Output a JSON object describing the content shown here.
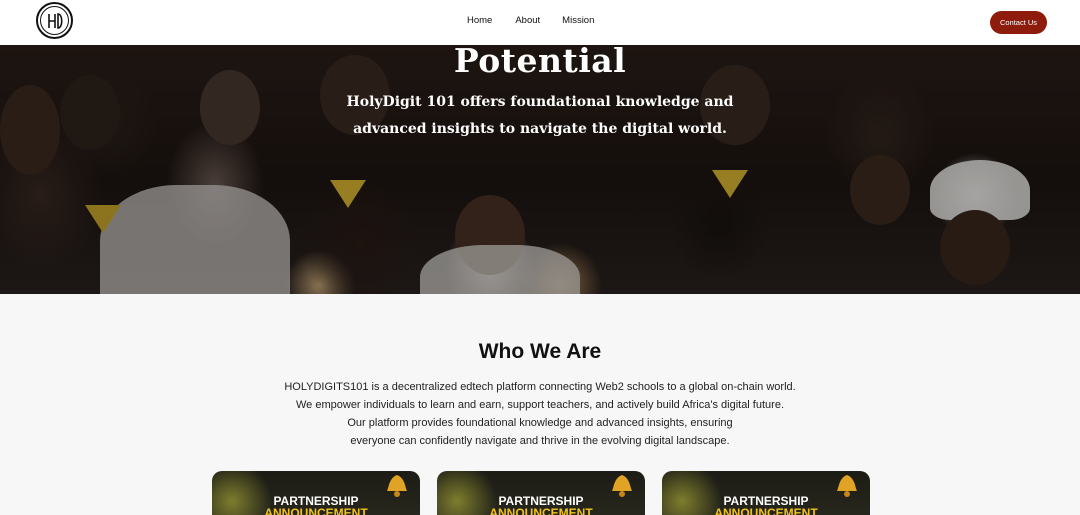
{
  "nav": {
    "links": [
      "Home",
      "About",
      "Mission"
    ],
    "contact_label": "Contact Us",
    "logo_icon": "holydigit-logo-icon"
  },
  "hero": {
    "title": "Potential",
    "subtitle_line1": "HolyDigit 101 offers foundational knowledge and",
    "subtitle_line2": "advanced insights to navigate the digital world."
  },
  "who": {
    "title": "Who We Are",
    "lines": [
      "HOLYDIGITS101 is a decentralized edtech platform connecting Web2 schools to a global on-chain world.",
      "We empower individuals to learn and earn, support teachers, and actively build Africa's digital future.",
      "Our platform provides foundational knowledge and advanced insights, ensuring",
      "everyone can confidently navigate and thrive in the evolving digital landscape."
    ]
  },
  "cards": [
    {
      "line1": "PARTNERSHIP",
      "line2": "ANNOUNCEMENT"
    },
    {
      "line1": "PARTNERSHIP",
      "line2": "ANNOUNCEMENT"
    },
    {
      "line1": "PARTNERSHIP",
      "line2": "ANNOUNCEMENT"
    }
  ],
  "colors": {
    "contact_button": "#8e1c0c",
    "card_accent": "#f2c418"
  }
}
